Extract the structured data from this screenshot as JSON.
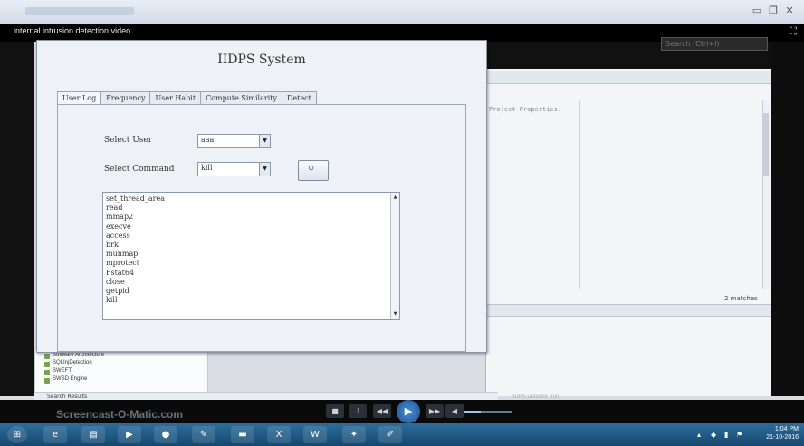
{
  "video": {
    "title": "internal intrusion detection video"
  },
  "ide": {
    "search_placeholder": "Search (Ctrl+I)",
    "property_text": "Project Properties.",
    "matches": "2 matches",
    "tree": [
      "Software Architecture",
      "SQLInjDetection",
      "SWEFT",
      "SWSD Engine"
    ],
    "search_results": "Search Results",
    "status_project": "IIDPS Detector (run)"
  },
  "dialog": {
    "title": "IIDPS System",
    "tabs": [
      "User Log",
      "Frequency",
      "User Habit",
      "Compute Similarity",
      "Detect"
    ],
    "active_tab": 0,
    "select_user_label": "Select User",
    "select_user_value": "aaa",
    "select_command_label": "Select Command",
    "select_command_value": "kill",
    "commands": [
      "set_thread_area",
      "read",
      "mmap2",
      "execve",
      "access",
      "brk",
      "munmap",
      "mprotect",
      "Fstat64",
      "close",
      "getpid",
      "kill"
    ]
  },
  "player": {
    "watermark": "Screencast-O-Matic.com",
    "progress_fraction": 0.35
  },
  "taskbar": {
    "time": "1:04 PM",
    "date": "21-10-2016"
  }
}
